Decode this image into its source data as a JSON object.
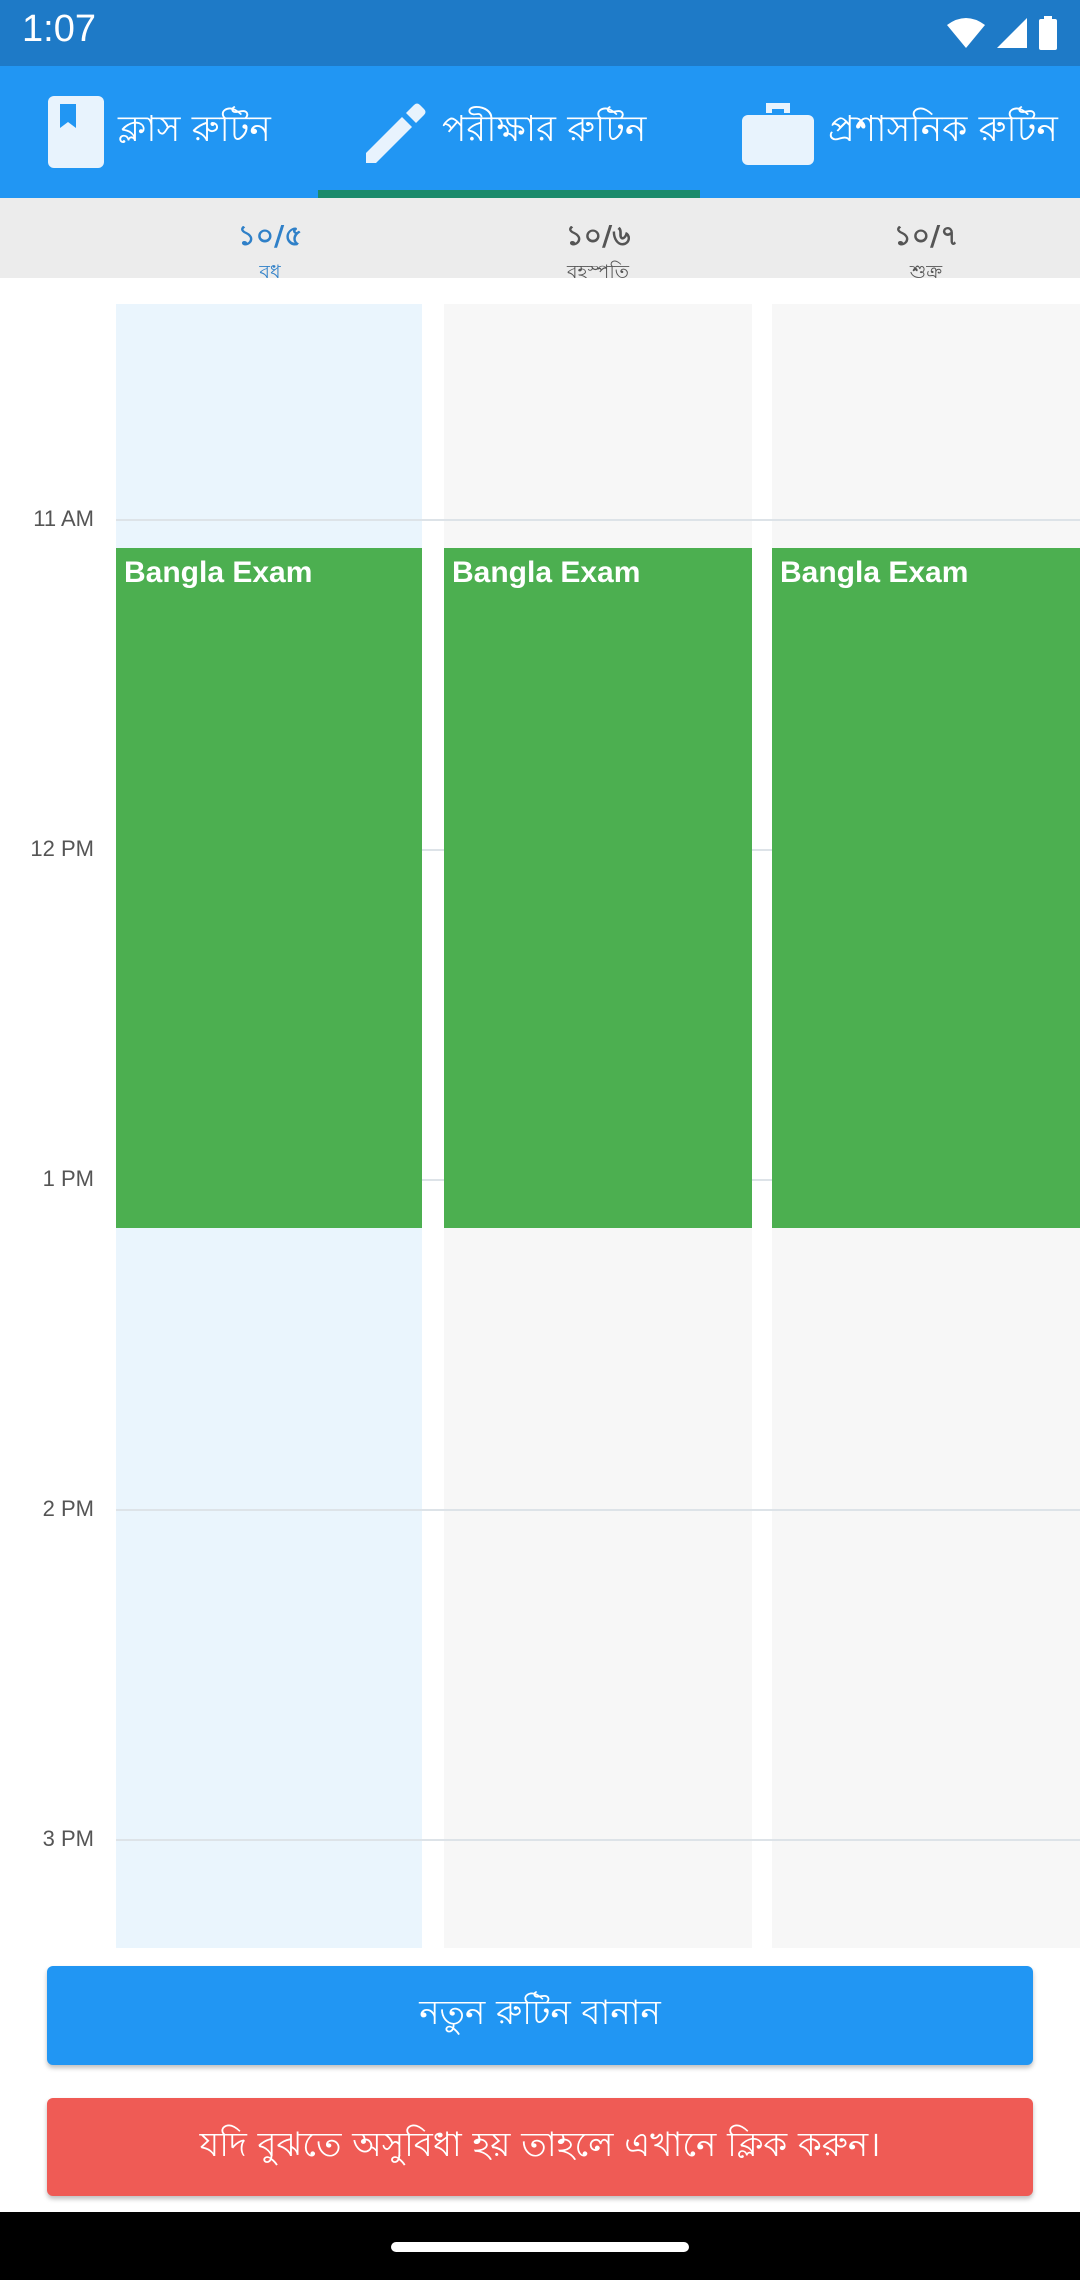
{
  "status_bar": {
    "time": "1:07",
    "icons": [
      "wifi-icon",
      "signal-icon",
      "battery-icon"
    ]
  },
  "tabs": [
    {
      "label": "ক্লাস রুটিন",
      "icon": "bookmark-book-icon",
      "selected": false
    },
    {
      "label": "পরীক্ষার রুটিন",
      "icon": "pencil-icon",
      "selected": true
    },
    {
      "label": "প্রশাসনিক রুটিন",
      "icon": "briefcase-icon",
      "selected": false
    }
  ],
  "days": [
    {
      "date": "১০/৫",
      "name": "বুধ",
      "active": true
    },
    {
      "date": "১০/৬",
      "name": "বৃহস্পতি",
      "active": false
    },
    {
      "date": "১০/৭",
      "name": "শুক্র",
      "active": false
    }
  ],
  "time_labels": [
    "11 AM",
    "12 PM",
    "1 PM",
    "2 PM",
    "3 PM"
  ],
  "events": [
    {
      "title": "Bangla Exam",
      "day": "১০/৫",
      "start": "10:55",
      "end": "1:10",
      "color": "#4caf50"
    },
    {
      "title": "Bangla Exam",
      "day": "১০/৬",
      "start": "10:55",
      "end": "1:10",
      "color": "#4caf50"
    },
    {
      "title": "Bangla Exam",
      "day": "১০/৭",
      "start": "10:55",
      "end": "1:10",
      "color": "#4caf50"
    }
  ],
  "buttons": {
    "new_routine": "নতুন রুটিন বানান",
    "help": "যদি বুঝতে অসুবিধা হয় তাহলে এখানে ক্লিক করুন।"
  },
  "colors": {
    "status_bar": "#1e7ac7",
    "primary": "#2196f3",
    "tab_indicator": "#1b8a6b",
    "event": "#4caf50",
    "help_button": "#ef5b55"
  }
}
